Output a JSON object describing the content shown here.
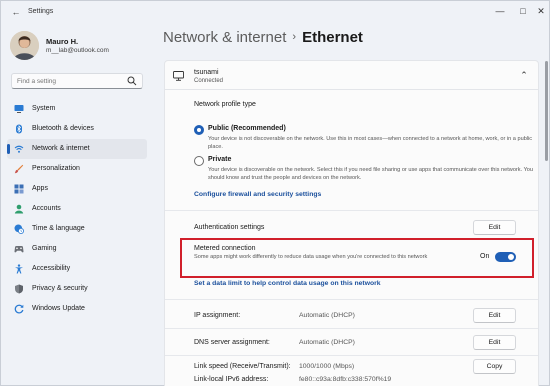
{
  "window": {
    "title": "Settings"
  },
  "user": {
    "name": "Mauro H.",
    "email": "m__lab@outlook.com"
  },
  "search": {
    "placeholder": "Find a setting"
  },
  "sidebar": {
    "items": [
      {
        "label": "System",
        "icon": "monitor-icon"
      },
      {
        "label": "Bluetooth & devices",
        "icon": "bluetooth-icon"
      },
      {
        "label": "Network & internet",
        "icon": "wifi-icon",
        "active": true
      },
      {
        "label": "Personalization",
        "icon": "brush-icon"
      },
      {
        "label": "Apps",
        "icon": "apps-icon"
      },
      {
        "label": "Accounts",
        "icon": "person-icon"
      },
      {
        "label": "Time & language",
        "icon": "globe-clock-icon"
      },
      {
        "label": "Gaming",
        "icon": "gamepad-icon"
      },
      {
        "label": "Accessibility",
        "icon": "accessibility-icon"
      },
      {
        "label": "Privacy & security",
        "icon": "shield-icon"
      },
      {
        "label": "Windows Update",
        "icon": "update-icon"
      }
    ]
  },
  "breadcrumb": {
    "parent": "Network & internet",
    "separator": "›",
    "current": "Ethernet"
  },
  "network": {
    "name": "tsunami",
    "status": "Connected"
  },
  "profile": {
    "section_title": "Network profile type",
    "public_label": "Public (Recommended)",
    "public_desc": "Your device is not discoverable on the network. Use this in most cases—when connected to a network at home, work, or in a public place.",
    "private_label": "Private",
    "private_desc": "Your device is discoverable on the network. Select this if you need file sharing or use apps that communicate over this network. You should know and trust the people and devices on the network.",
    "selected": "public",
    "firewall_link": "Configure firewall and security settings"
  },
  "auth": {
    "label": "Authentication settings",
    "button": "Edit"
  },
  "metered": {
    "label": "Metered connection",
    "desc": "Some apps might work differently to reduce data usage when you're connected to this network",
    "state_label": "On",
    "on": true,
    "data_limit_link": "Set a data limit to help control data usage on this network"
  },
  "ip": {
    "label": "IP assignment:",
    "value": "Automatic (DHCP)",
    "button": "Edit"
  },
  "dns": {
    "label": "DNS server assignment:",
    "value": "Automatic (DHCP)",
    "button": "Edit"
  },
  "link_speed": {
    "label": "Link speed (Receive/Transmit):",
    "value": "1000/1000 (Mbps)",
    "button": "Copy"
  },
  "ipv6": {
    "label": "Link-local IPv6 address:",
    "value": "fe80::c93a:8dfb:c338:570f%19"
  },
  "colors": {
    "accent": "#1f5fb6",
    "highlight_border": "#d11f2b"
  }
}
